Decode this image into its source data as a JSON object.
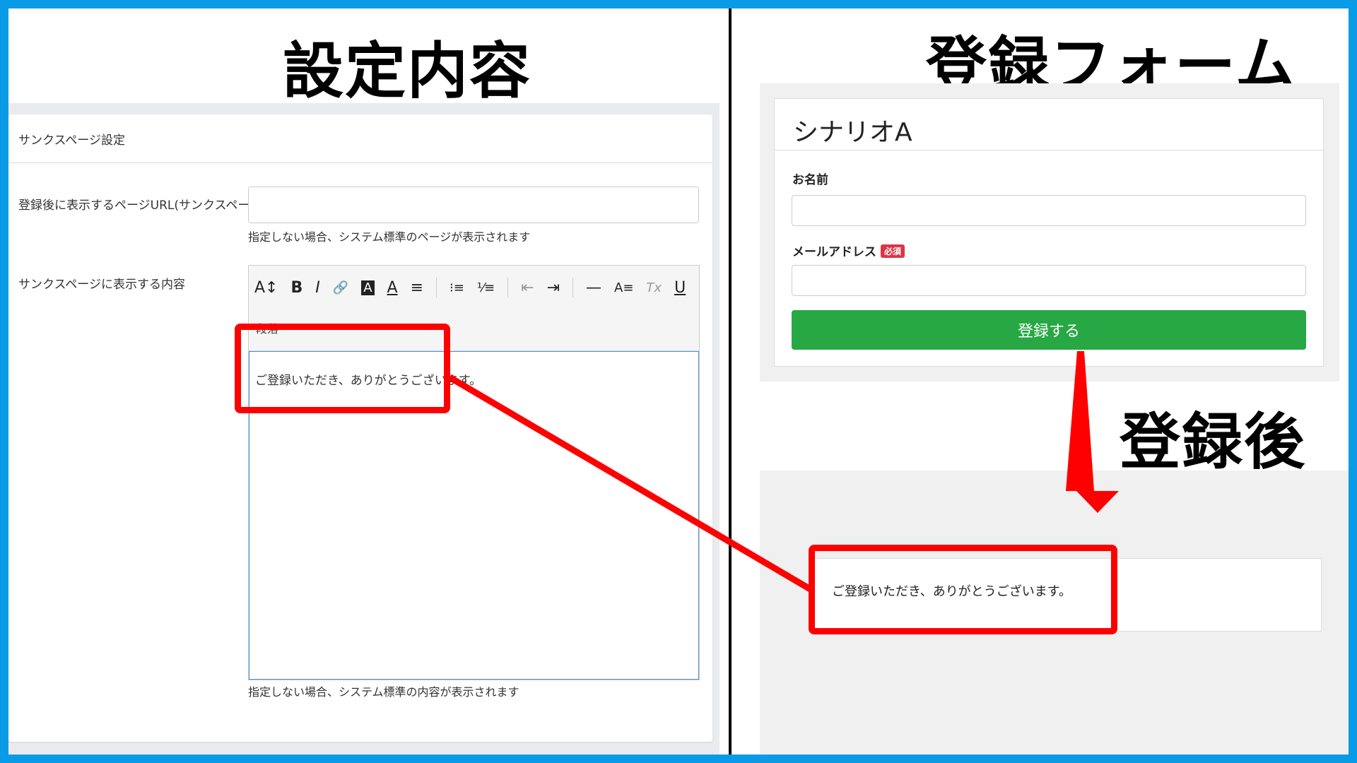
{
  "titles": {
    "left": "設定内容",
    "right": "登録フォーム",
    "after": "登録後"
  },
  "settings": {
    "header": "サンクスページ設定",
    "url_label": "登録後に表示するページURL(サンクスページ)",
    "url_help": "指定しない場合、システム標準のページが表示されます",
    "content_label": "サンクスページに表示する内容",
    "content_help": "指定しない場合、システム標準の内容が表示されます",
    "editor": {
      "paragraph_select": "段落",
      "body_text": "ご登録いただき、ありがとうございます。",
      "toolbar": {
        "font_size": "A↕",
        "bold": "B",
        "italic": "I",
        "link": "🔗",
        "bg_color": "A",
        "text_color": "A",
        "align": "≡",
        "bullet_list": "⁝≡",
        "number_list": "⅟≡",
        "outdent": "⇤",
        "indent": "⇥",
        "hr": "—",
        "format": "A≡",
        "clear": "Tx",
        "underline": "U",
        "caret": "⌄"
      }
    }
  },
  "form": {
    "title": "シナリオA",
    "name_label": "お名前",
    "email_label": "メールアドレス",
    "required_badge": "必須",
    "submit_label": "登録する"
  },
  "after": {
    "message": "ご登録いただき、ありがとうございます。"
  },
  "colors": {
    "frame": "#0a9be6",
    "highlight": "#ff0000",
    "submit": "#28a745",
    "badge": "#dc3545"
  }
}
